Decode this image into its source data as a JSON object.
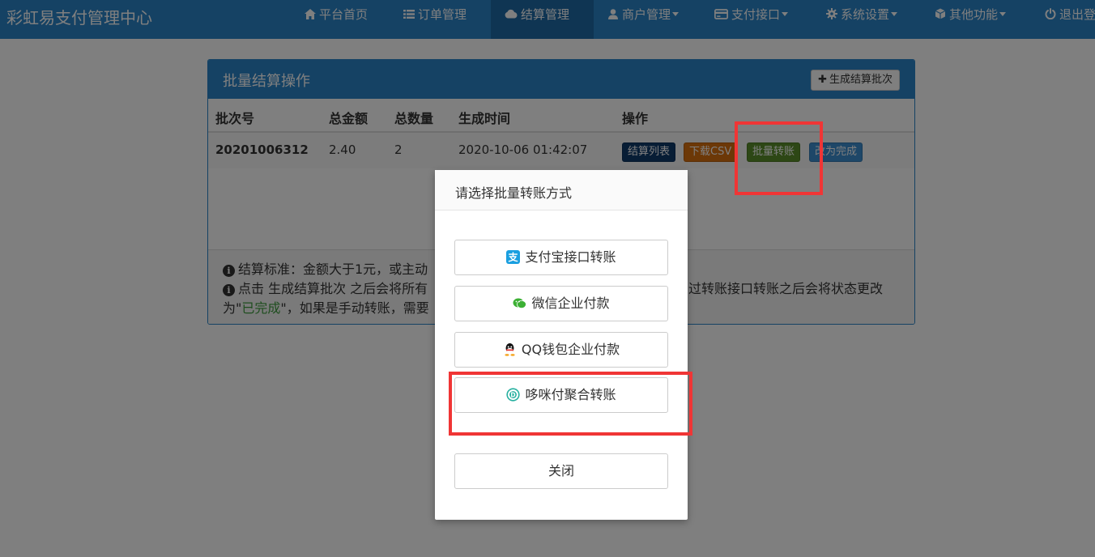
{
  "app": {
    "brand": "彩虹易支付管理中心"
  },
  "nav": [
    {
      "label": "平台首页",
      "icon": "home-icon",
      "dropdown": false,
      "active": false
    },
    {
      "label": "订单管理",
      "icon": "list-icon",
      "dropdown": false,
      "active": false
    },
    {
      "label": "结算管理",
      "icon": "cloud-icon",
      "dropdown": false,
      "active": true
    },
    {
      "label": "商户管理",
      "icon": "user-icon",
      "dropdown": true,
      "active": false
    },
    {
      "label": "支付接口",
      "icon": "credit-card-icon",
      "dropdown": true,
      "active": false
    },
    {
      "label": "系统设置",
      "icon": "gear-icon",
      "dropdown": true,
      "active": false
    },
    {
      "label": "其他功能",
      "icon": "cube-icon",
      "dropdown": true,
      "active": false
    },
    {
      "label": "退出登",
      "icon": "power-icon",
      "dropdown": false,
      "active": false
    }
  ],
  "panel": {
    "title": "批量结算操作",
    "generate_label": "生成结算批次",
    "columns": [
      "批次号",
      "总金额",
      "总数量",
      "生成时间",
      "操作"
    ],
    "row": {
      "batch": "2020100631 2",
      "amount": "2.40",
      "count": "2",
      "time": "2020-10-06 01:42:07"
    },
    "actions": [
      {
        "label": "结算列表",
        "color": "#0f3a6b"
      },
      {
        "label": "下载CSV",
        "color": "#d9700e"
      },
      {
        "label": "批量转账",
        "color": "#5a8e2a"
      },
      {
        "label": "改为完成",
        "color": "#3c8fd0"
      }
    ],
    "notes": {
      "line1": "结算标准：金额大于1元，或主动",
      "line2a": "点击 生成结算批次 之后会将所有",
      "line2b": "过转账接口转账之后会将状态更改",
      "line3a": "为\"",
      "line3b": "已完成",
      "line3c": "\"，如果是手动转账，需要"
    }
  },
  "modal": {
    "title": "请选择批量转账方式",
    "options": [
      {
        "label": "支付宝接口转账",
        "icon": "alipay-icon"
      },
      {
        "label": "微信企业付款",
        "icon": "wechat-icon"
      },
      {
        "label": "QQ钱包企业付款",
        "icon": "qq-icon"
      },
      {
        "label": "哆咪付聚合转账",
        "icon": "duomi-icon"
      }
    ],
    "close_label": "关闭"
  },
  "colors": {
    "navbar": "#2a84c8",
    "highlight": "#f03535",
    "completed": "#3c9b3c"
  }
}
